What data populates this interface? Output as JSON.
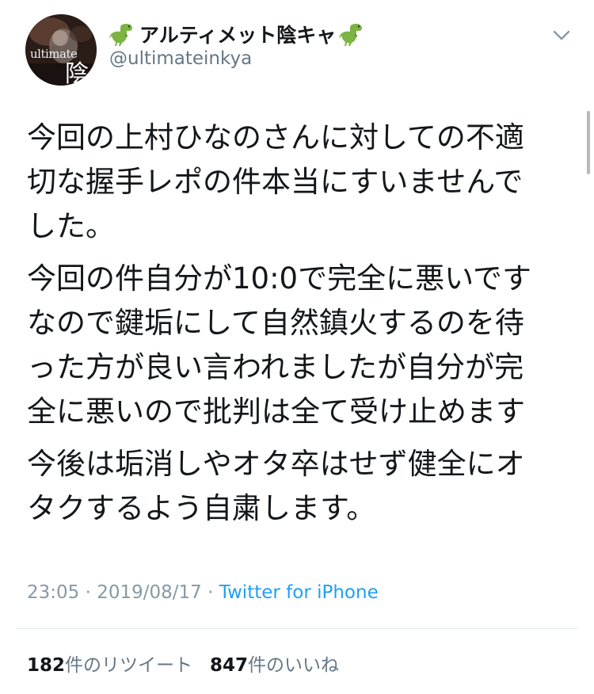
{
  "author": {
    "display_name": "アルティメット陰キャ",
    "handle": "@ultimateinkya",
    "name_emoji": "dinosaur-icon",
    "avatar_text": "ultimate",
    "avatar_kanji": "陰"
  },
  "tweet": {
    "paragraphs": [
      "今回の上村ひなのさんに対しての不適\n切な握手レポの件本当にすいませんで\nした。",
      "今回の件自分が10:0で完全に悪いです\nなので鍵垢にして自然鎮火するのを待\nった方が良い言われましたが自分が完\n全に悪いので批判は全て受け止めます",
      "今後は垢消しやオタ卒はせず健全にオ\nタクするよう自粛します。"
    ],
    "time": "23:05",
    "separator": "·",
    "date": "2019/08/17",
    "source": "Twitter for iPhone"
  },
  "stats": {
    "retweets_count": "182",
    "retweets_label": "件のリツイート",
    "likes_count": "847",
    "likes_label": "件のいいね"
  },
  "colors": {
    "text": "#14171a",
    "secondary": "#657786",
    "link": "#1da1f2",
    "meta": "#8899a6",
    "divider": "#e1e8ed"
  }
}
